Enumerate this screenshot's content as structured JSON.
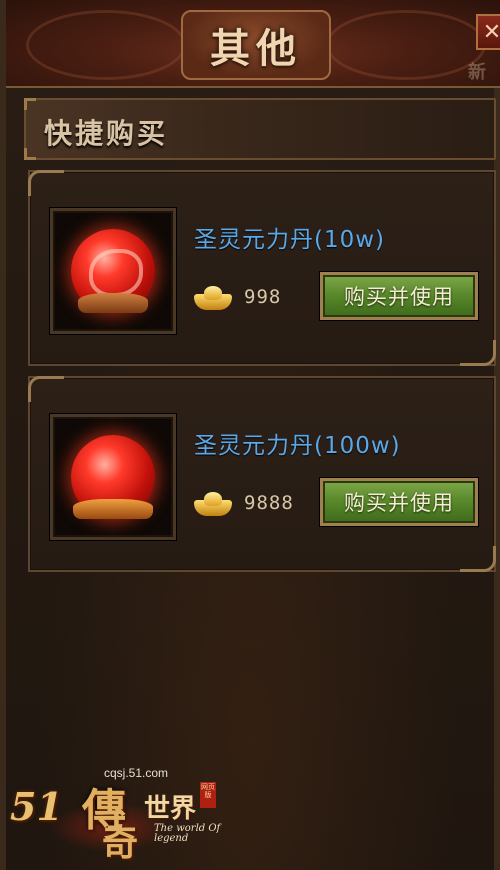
{
  "window": {
    "title": "其他",
    "close_label": "✕",
    "corner_partial_text": "新"
  },
  "section": {
    "title": "快捷购买"
  },
  "items": [
    {
      "name": "圣灵元力丹(10w)",
      "price": "998",
      "currency_icon": "gold-ingot-icon",
      "button_label": "购买并使用",
      "icon": "red-dragon-orb-icon"
    },
    {
      "name": "圣灵元力丹(100w)",
      "price": "9888",
      "currency_icon": "gold-ingot-icon",
      "button_label": "购买并使用",
      "icon": "red-orb-on-stand-icon"
    }
  ],
  "watermark": {
    "number": "51",
    "url": "cqsj.51.com",
    "char1": "傳",
    "char2": "奇",
    "world": "世界",
    "english": "The world Of legend",
    "seal": "网页版"
  },
  "colors": {
    "item_name": "#5aa8e8",
    "button_green": "#5a8a2c",
    "frame_gold": "#a08050"
  }
}
